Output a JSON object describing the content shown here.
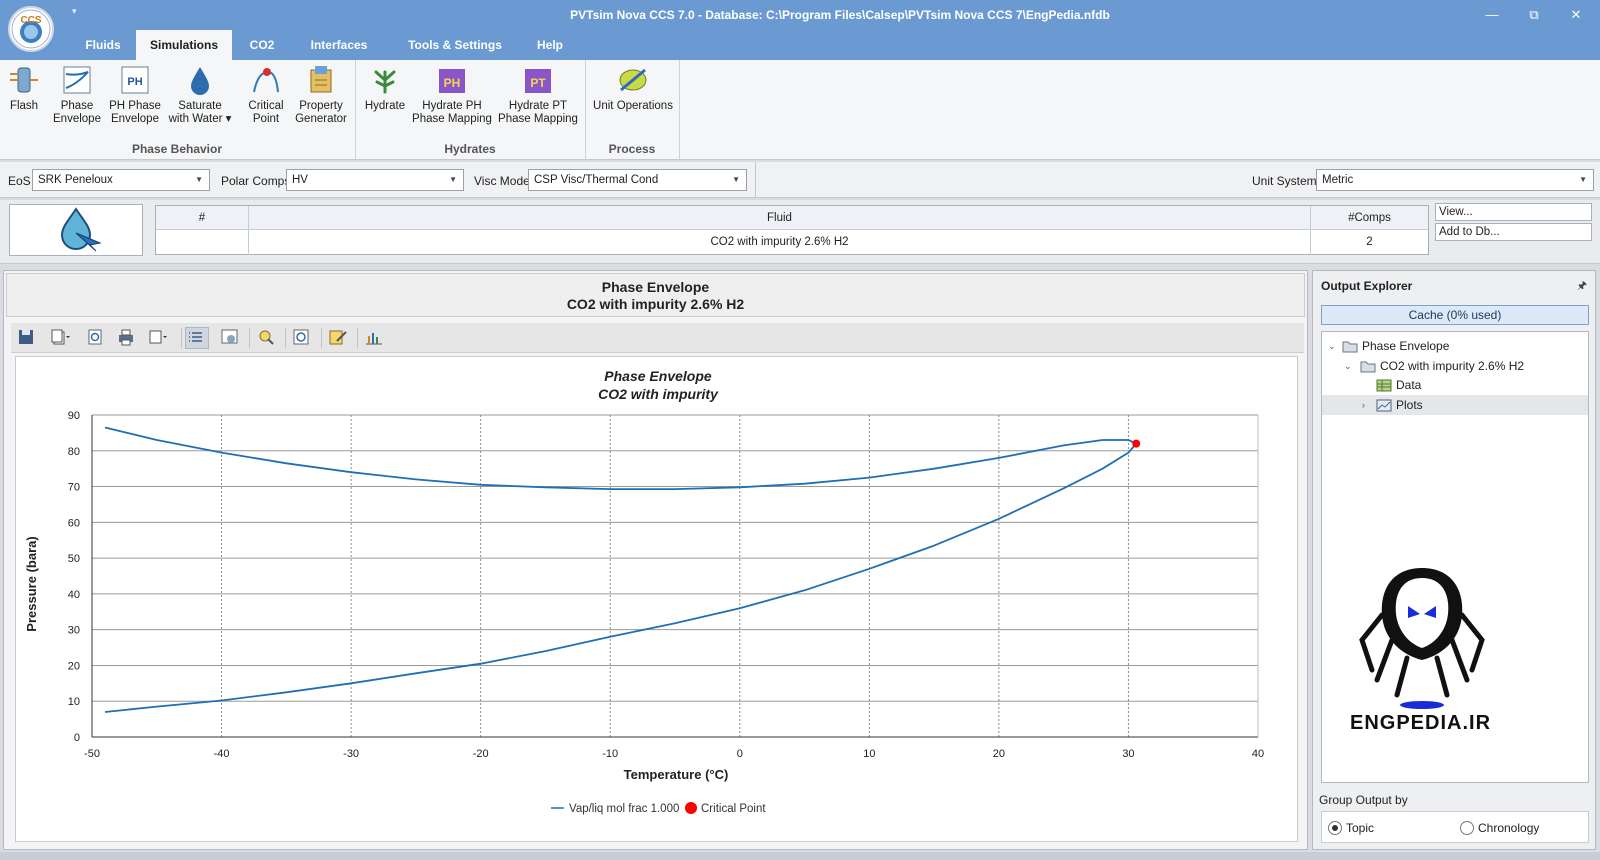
{
  "window": {
    "title": "PVTsim Nova CCS 7.0 - Database: C:\\Program Files\\Calsep\\PVTsim Nova CCS 7\\EngPedia.nfdb",
    "logo_text": "CCS",
    "minimize": "—",
    "restore": "⧉",
    "close": "✕"
  },
  "tabs": [
    "Fluids",
    "Simulations",
    "CO2",
    "Interfaces",
    "Tools & Settings",
    "Help"
  ],
  "ribbon": {
    "buttons": [
      {
        "line1": "Flash",
        "line2": ""
      },
      {
        "line1": "Phase",
        "line2": "Envelope"
      },
      {
        "line1": "PH Phase",
        "line2": "Envelope"
      },
      {
        "line1": "Saturate",
        "line2": "with Water ▾"
      },
      {
        "line1": "Critical",
        "line2": "Point"
      },
      {
        "line1": "Property",
        "line2": "Generator"
      },
      {
        "line1": "Hydrate",
        "line2": ""
      },
      {
        "line1": "Hydrate PH",
        "line2": "Phase Mapping"
      },
      {
        "line1": "Hydrate PT",
        "line2": "Phase Mapping"
      },
      {
        "line1": "Unit Operations",
        "line2": ""
      }
    ],
    "groups": [
      "Phase Behavior",
      "Hydrates",
      "Process"
    ]
  },
  "model_bar": {
    "eos_label": "EoS",
    "eos_value": "SRK Peneloux",
    "polar_label": "Polar Comps",
    "polar_value": "HV",
    "visc_label": "Visc Model",
    "visc_value": "CSP Visc/Thermal Cond",
    "unit_label": "Unit System",
    "unit_value": "Metric"
  },
  "fluid_table": {
    "headers": [
      "#",
      "Fluid",
      "#Comps"
    ],
    "rows": [
      {
        "num": "",
        "fluid": "CO2 with impurity 2.6% H2",
        "comps": "2"
      }
    ],
    "view_button": "View...",
    "add_button": "Add to Db..."
  },
  "document": {
    "title_line1": "Phase Envelope",
    "title_line2": "CO2 with impurity 2.6% H2"
  },
  "toolbar_icons": [
    "save-icon",
    "copy-icon",
    "zoom-icon",
    "print-icon",
    "export-icon",
    "table-view-icon",
    "plot-settings-icon",
    "zoom-in-icon",
    "zoom-extent-icon",
    "edit-icon",
    "chart-icon"
  ],
  "chart_data": {
    "type": "line",
    "title": "Phase Envelope",
    "subtitle": "CO2 with impurity",
    "xlabel": "Temperature (°C)",
    "ylabel": "Pressure (bara)",
    "xlim": [
      -50,
      40
    ],
    "ylim": [
      0,
      90
    ],
    "xticks": [
      -50,
      -40,
      -30,
      -20,
      -10,
      0,
      10,
      20,
      30,
      40
    ],
    "yticks": [
      0,
      10,
      20,
      30,
      40,
      50,
      60,
      70,
      80,
      90
    ],
    "grid": true,
    "legend_position": "bottom",
    "series": [
      {
        "name": "Vap/liq mol frac 1.000",
        "color": "#1f6fb5",
        "points": [
          [
            -49,
            7.0
          ],
          [
            -45,
            8.5
          ],
          [
            -40,
            10.2
          ],
          [
            -35,
            12.5
          ],
          [
            -30,
            15.0
          ],
          [
            -25,
            17.8
          ],
          [
            -20,
            20.5
          ],
          [
            -15,
            24.0
          ],
          [
            -10,
            28.0
          ],
          [
            -5,
            31.8
          ],
          [
            0,
            36.0
          ],
          [
            5,
            41.0
          ],
          [
            10,
            47.0
          ],
          [
            15,
            53.5
          ],
          [
            20,
            61.0
          ],
          [
            25,
            69.5
          ],
          [
            28,
            75.0
          ],
          [
            30,
            79.5
          ],
          [
            30.6,
            82.0
          ],
          [
            30,
            83.0
          ],
          [
            28,
            83.0
          ],
          [
            25,
            81.5
          ],
          [
            20,
            78.0
          ],
          [
            15,
            75.0
          ],
          [
            10,
            72.5
          ],
          [
            5,
            70.8
          ],
          [
            0,
            69.8
          ],
          [
            -5,
            69.3
          ],
          [
            -10,
            69.3
          ],
          [
            -15,
            69.8
          ],
          [
            -20,
            70.5
          ],
          [
            -25,
            72.0
          ],
          [
            -30,
            74.0
          ],
          [
            -35,
            76.5
          ],
          [
            -40,
            79.5
          ],
          [
            -45,
            83.0
          ],
          [
            -49,
            86.5
          ]
        ]
      }
    ],
    "critical_point": {
      "name": "Critical Point",
      "x": 30.6,
      "y": 82.0,
      "color": "#ff0000"
    }
  },
  "explorer": {
    "title": "Output Explorer",
    "pin": "🖈",
    "cache": "Cache (0% used)",
    "tree": [
      {
        "label": "Phase Envelope",
        "expander": "⌄"
      },
      {
        "label": "CO2 with impurity 2.6% H2",
        "expander": "⌄"
      },
      {
        "label": "Data",
        "expander": ""
      },
      {
        "label": "Plots",
        "expander": "›"
      }
    ],
    "watermark_text": "ENGPEDIA.IR",
    "group_label": "Group Output by",
    "options": [
      "Topic",
      "Chronology"
    ]
  }
}
